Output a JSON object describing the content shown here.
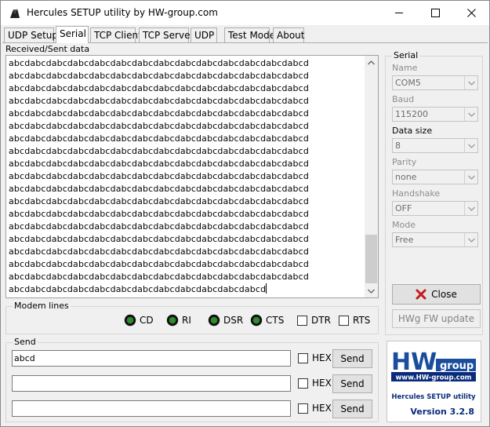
{
  "window": {
    "title": "Hercules SETUP utility by HW-group.com",
    "icons": {
      "app": "hercules-app-icon",
      "minimize": "minimize-icon",
      "maximize": "maximize-icon",
      "close": "close-icon"
    }
  },
  "tabs": [
    {
      "label": "UDP Setup",
      "active": false
    },
    {
      "label": "Serial",
      "active": true
    },
    {
      "label": "TCP Client",
      "active": false
    },
    {
      "label": "TCP Server",
      "active": false
    },
    {
      "label": "UDP",
      "active": false
    },
    {
      "label": "Test Mode",
      "active": false
    },
    {
      "label": "About",
      "active": false
    }
  ],
  "received": {
    "label": "Received/Sent data",
    "lines": [
      "abcdabcdabcdabcdabcdabcdabcdabcdabcdabcdabcdabcdabcdabcd",
      "abcdabcdabcdabcdabcdabcdabcdabcdabcdabcdabcdabcdabcdabcd",
      "abcdabcdabcdabcdabcdabcdabcdabcdabcdabcdabcdabcdabcdabcd",
      "abcdabcdabcdabcdabcdabcdabcdabcdabcdabcdabcdabcdabcdabcd",
      "abcdabcdabcdabcdabcdabcdabcdabcdabcdabcdabcdabcdabcdabcd",
      "abcdabcdabcdabcdabcdabcdabcdabcdabcdabcdabcdabcdabcdabcd",
      "abcdabcdabcdabcdabcdabcdabcdabcdabcdabcdabcdabcdabcdabcd",
      "abcdabcdabcdabcdabcdabcdabcdabcdabcdabcdabcdabcdabcdabcd",
      "abcdabcdabcdabcdabcdabcdabcdabcdabcdabcdabcdabcdabcdabcd",
      "abcdabcdabcdabcdabcdabcdabcdabcdabcdabcdabcdabcdabcdabcd",
      "abcdabcdabcdabcdabcdabcdabcdabcdabcdabcdabcdabcdabcdabcd",
      "abcdabcdabcdabcdabcdabcdabcdabcdabcdabcdabcdabcdabcdabcd",
      "abcdabcdabcdabcdabcdabcdabcdabcdabcdabcdabcdabcdabcdabcd",
      "abcdabcdabcdabcdabcdabcdabcdabcdabcdabcdabcdabcdabcdabcd",
      "abcdabcdabcdabcdabcdabcdabcdabcdabcdabcdabcdabcdabcdabcd",
      "abcdabcdabcdabcdabcdabcdabcdabcdabcdabcdabcdabcdabcdabcd",
      "abcdabcdabcdabcdabcdabcdabcdabcdabcdabcdabcdabcdabcdabcd",
      "abcdabcdabcdabcdabcdabcdabcdabcdabcdabcdabcdabcdabcdabcd",
      "abcdabcdabcdabcdabcdabcdabcdabcdabcdabcdabcdabcd"
    ]
  },
  "serial": {
    "title": "Serial",
    "fields": [
      {
        "label": "Name",
        "value": "COM5",
        "enabled": false
      },
      {
        "label": "Baud",
        "value": "115200",
        "enabled": false
      },
      {
        "label": "Data size",
        "value": "8",
        "enabled": true
      },
      {
        "label": "Parity",
        "value": "none",
        "enabled": false
      },
      {
        "label": "Handshake",
        "value": "OFF",
        "enabled": false
      },
      {
        "label": "Mode",
        "value": "Free",
        "enabled": false
      }
    ],
    "close_button": "Close",
    "close_icon": "red-x-icon",
    "fw_update_button": "HWg FW update"
  },
  "modem": {
    "title": "Modem lines",
    "leds": [
      {
        "label": "CD",
        "on": true,
        "color": "#2e8b2e"
      },
      {
        "label": "RI",
        "on": true,
        "color": "#2e8b2e"
      },
      {
        "label": "DSR",
        "on": true,
        "color": "#2e8b2e"
      },
      {
        "label": "CTS",
        "on": true,
        "color": "#2e8b2e"
      }
    ],
    "checkboxes": [
      {
        "label": "DTR",
        "checked": false
      },
      {
        "label": "RTS",
        "checked": false
      }
    ]
  },
  "send": {
    "title": "Send",
    "rows": [
      {
        "value": "abcd",
        "hex_label": "HEX",
        "hex_checked": false,
        "button": "Send"
      },
      {
        "value": "",
        "hex_label": "HEX",
        "hex_checked": false,
        "button": "Send"
      },
      {
        "value": "",
        "hex_label": "HEX",
        "hex_checked": false,
        "button": "Send"
      }
    ]
  },
  "logo": {
    "brand_hw": "HW",
    "brand_group": "group",
    "url": "www.HW-group.com",
    "product": "Hercules SETUP utility",
    "version": "Version  3.2.8",
    "colors": {
      "blue": "#1a4d9e",
      "navy": "#0a2b7a"
    }
  }
}
